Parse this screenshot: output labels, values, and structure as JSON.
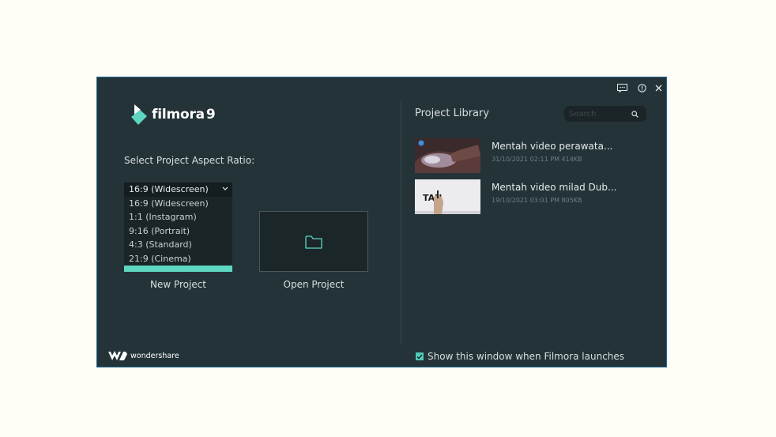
{
  "app": {
    "logo_text": "filmora",
    "logo_version": "9",
    "brand": "wondershare"
  },
  "left": {
    "aspect_label": "Select Project Aspect Ratio:",
    "dropdown_selected": "16:9 (Widescreen)",
    "dropdown_options": [
      "16:9 (Widescreen)",
      "1:1 (Instagram)",
      "9:16 (Portrait)",
      "4:3 (Standard)",
      "21:9 (Cinema)"
    ],
    "new_project": "New Project",
    "open_project": "Open Project"
  },
  "library": {
    "title": "Project Library",
    "search_placeholder": "Search",
    "items": [
      {
        "title": "Mentah video perawata...",
        "date": "31/10/2021 02:11 PM",
        "size": "414KB"
      },
      {
        "title": "Mentah video milad Dub...",
        "date": "19/10/2021 03:01 PM",
        "size": "805KB",
        "thumb_text": "TAN"
      }
    ]
  },
  "footer": {
    "show_on_launch": "Show this window when Filmora launches"
  },
  "colors": {
    "window_bg": "#243338",
    "accent": "#5dd6c2",
    "border": "#1c6a95"
  },
  "icons": [
    "feedback-icon",
    "info-icon",
    "close-icon",
    "search-icon",
    "folder-icon",
    "chevron-down-icon",
    "check-icon"
  ]
}
